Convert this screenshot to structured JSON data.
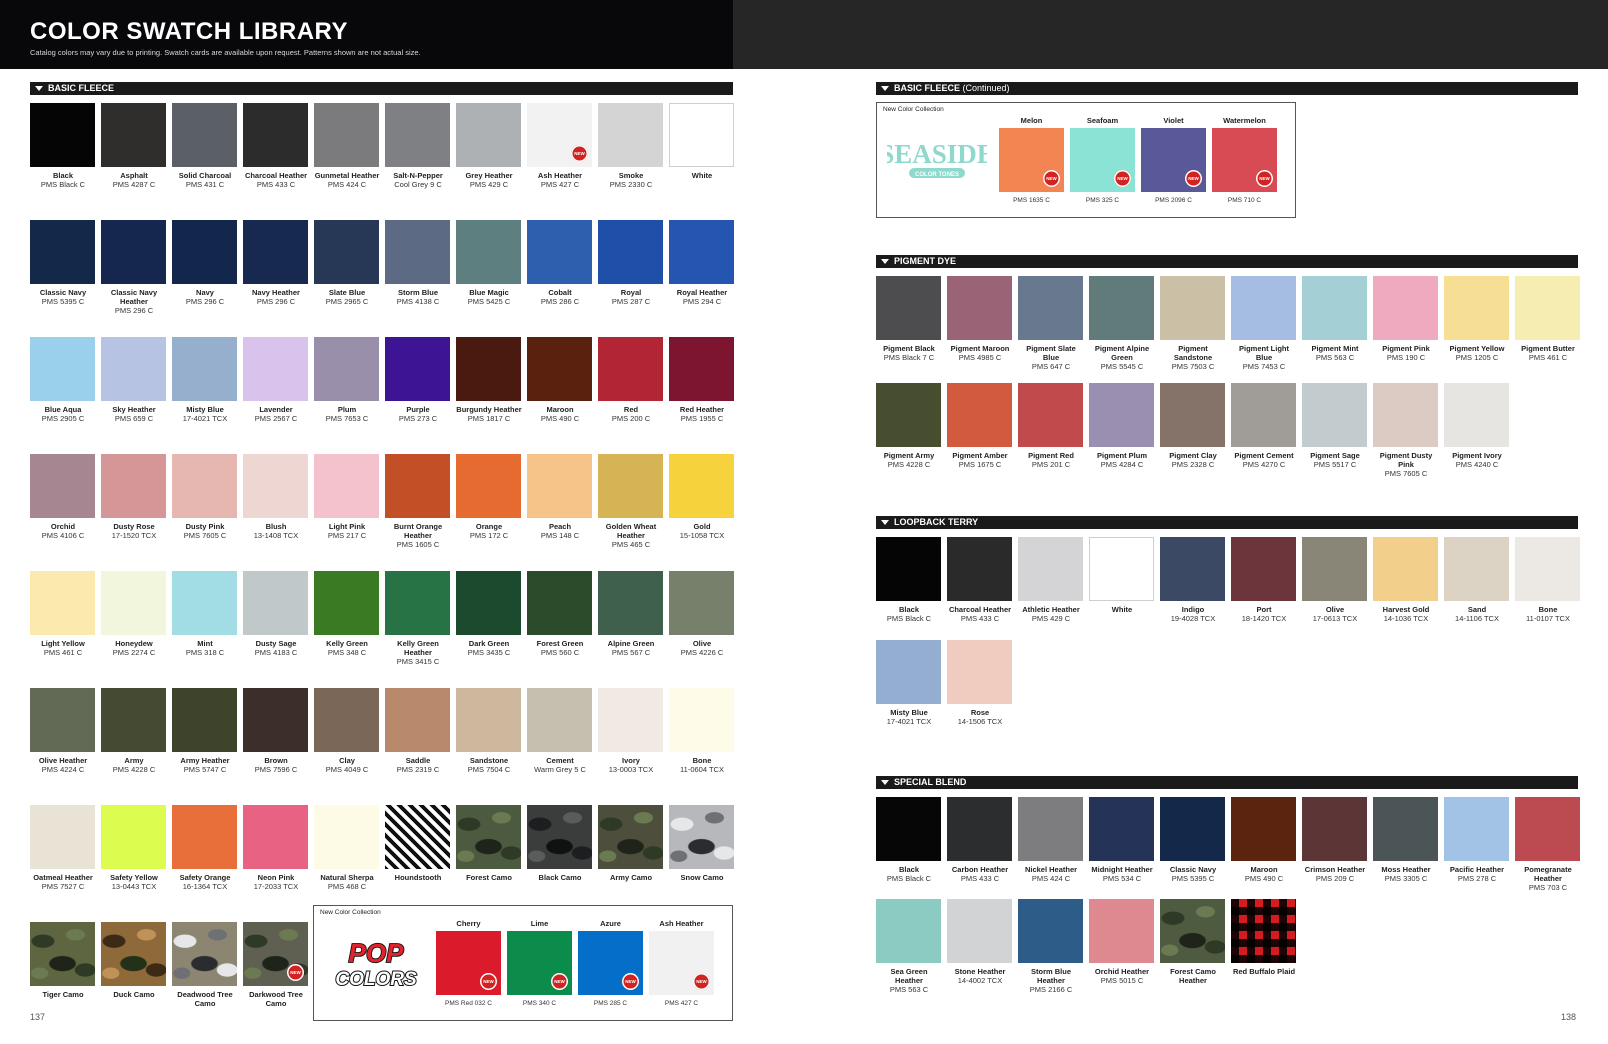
{
  "header": {
    "title": "COLOR SWATCH LIBRARY",
    "subtitle": "Catalog colors may vary due to printing. Swatch cards are available upon request. Patterns shown are not actual size."
  },
  "pages": {
    "left": "137",
    "right": "138"
  },
  "sections": {
    "basic_fleece": "BASIC FLEECE",
    "basic_fleece_cont": "BASIC FLEECE",
    "basic_fleece_cont_note": "(Continued)",
    "pigment_dye": "PIGMENT DYE",
    "loopback_terry": "LOOPBACK TERRY",
    "special_blend": "SPECIAL BLEND"
  },
  "new_badge": "NEW",
  "basic_fleece": [
    {
      "name": "Black",
      "pms": "PMS Black C",
      "color": "#050505"
    },
    {
      "name": "Asphalt",
      "pms": "PMS 4287 C",
      "color": "#302e2d"
    },
    {
      "name": "Solid Charcoal",
      "pms": "PMS 431 C",
      "color": "#5b6066"
    },
    {
      "name": "Charcoal Heather",
      "pms": "PMS 433 C",
      "color": "#2c2c2d"
    },
    {
      "name": "Gunmetal Heather",
      "pms": "PMS 424 C",
      "color": "#7b7b7d"
    },
    {
      "name": "Salt-N-Pepper",
      "pms": "Cool Grey 9 C",
      "color": "#7f8083"
    },
    {
      "name": "Grey Heather",
      "pms": "PMS 429 C",
      "color": "#aeb1b4"
    },
    {
      "name": "Ash Heather",
      "pms": "PMS 427 C",
      "color": "#f2f2f2",
      "new": true
    },
    {
      "name": "Smoke",
      "pms": "PMS 2330 C",
      "color": "#d4d4d4"
    },
    {
      "name": "White",
      "pms": "",
      "color": "#ffffff",
      "border": true
    },
    {
      "name": "Classic Navy",
      "pms": "PMS 5395 C",
      "color": "#14284a"
    },
    {
      "name": "Classic Navy Heather",
      "pms": "PMS 296 C",
      "color": "#15264f"
    },
    {
      "name": "Navy",
      "pms": "PMS 296 C",
      "color": "#13264c"
    },
    {
      "name": "Navy Heather",
      "pms": "PMS 296 C",
      "color": "#17294e"
    },
    {
      "name": "Slate Blue",
      "pms": "PMS 2965 C",
      "color": "#263855"
    },
    {
      "name": "Storm Blue",
      "pms": "PMS 4138 C",
      "color": "#5c6a84"
    },
    {
      "name": "Blue Magic",
      "pms": "PMS 5425 C",
      "color": "#5d7f80"
    },
    {
      "name": "Cobalt",
      "pms": "PMS 286 C",
      "color": "#2c5fad"
    },
    {
      "name": "Royal",
      "pms": "PMS 287 C",
      "color": "#1f4fa8"
    },
    {
      "name": "Royal Heather",
      "pms": "PMS 294 C",
      "color": "#2455b0"
    },
    {
      "name": "Blue Aqua",
      "pms": "PMS 2905 C",
      "color": "#9ad0ec"
    },
    {
      "name": "Sky Heather",
      "pms": "PMS 659 C",
      "color": "#b6c3e2"
    },
    {
      "name": "Misty Blue",
      "pms": "17-4021 TCX",
      "color": "#96afcc"
    },
    {
      "name": "Lavender",
      "pms": "PMS 2567 C",
      "color": "#d9c2ec"
    },
    {
      "name": "Plum",
      "pms": "PMS 7653 C",
      "color": "#9a8fab"
    },
    {
      "name": "Purple",
      "pms": "PMS 273 C",
      "color": "#3d1594"
    },
    {
      "name": "Burgundy Heather",
      "pms": "PMS 1817 C",
      "color": "#4a1a10"
    },
    {
      "name": "Maroon",
      "pms": "PMS 490 C",
      "color": "#5a220e"
    },
    {
      "name": "Red",
      "pms": "PMS 200 C",
      "color": "#b22534"
    },
    {
      "name": "Red Heather",
      "pms": "PMS 1955 C",
      "color": "#7e1530"
    },
    {
      "name": "Orchid",
      "pms": "PMS 4106 C",
      "color": "#a68690"
    },
    {
      "name": "Dusty Rose",
      "pms": "17-1520 TCX",
      "color": "#d49696"
    },
    {
      "name": "Dusty Pink",
      "pms": "PMS 7605 C",
      "color": "#e5b7b0"
    },
    {
      "name": "Blush",
      "pms": "13-1408 TCX",
      "color": "#eed6d2"
    },
    {
      "name": "Light Pink",
      "pms": "PMS 217 C",
      "color": "#f3c2cc"
    },
    {
      "name": "Burnt Orange Heather",
      "pms": "PMS 1605 C",
      "color": "#c24f25"
    },
    {
      "name": "Orange",
      "pms": "PMS 172 C",
      "color": "#e56b30"
    },
    {
      "name": "Peach",
      "pms": "PMS 148 C",
      "color": "#f6c488"
    },
    {
      "name": "Golden Wheat Heather",
      "pms": "PMS 465 C",
      "color": "#d6b354"
    },
    {
      "name": "Gold",
      "pms": "15-1058 TCX",
      "color": "#f6d23c"
    },
    {
      "name": "Light Yellow",
      "pms": "PMS 461 C",
      "color": "#fbe9ae"
    },
    {
      "name": "Honeydew",
      "pms": "PMS 2274 C",
      "color": "#f2f6dd"
    },
    {
      "name": "Mint",
      "pms": "PMS 318 C",
      "color": "#a2dde5"
    },
    {
      "name": "Dusty Sage",
      "pms": "PMS 4183 C",
      "color": "#c1c8c9"
    },
    {
      "name": "Kelly Green",
      "pms": "PMS 348 C",
      "color": "#3a7a22"
    },
    {
      "name": "Kelly Green Heather",
      "pms": "PMS 3415 C",
      "color": "#287345"
    },
    {
      "name": "Dark Green",
      "pms": "PMS 3435 C",
      "color": "#1c4a2e"
    },
    {
      "name": "Forest Green",
      "pms": "PMS 560 C",
      "color": "#2b4c2a"
    },
    {
      "name": "Alpine Green",
      "pms": "PMS 567 C",
      "color": "#3f604c"
    },
    {
      "name": "Olive",
      "pms": "PMS 4226 C",
      "color": "#77806a"
    },
    {
      "name": "Olive Heather",
      "pms": "PMS 4224 C",
      "color": "#626a55"
    },
    {
      "name": "Army",
      "pms": "PMS 4228 C",
      "color": "#444b32"
    },
    {
      "name": "Army Heather",
      "pms": "PMS 5747 C",
      "color": "#3e432b"
    },
    {
      "name": "Brown",
      "pms": "PMS 7596 C",
      "color": "#3c2e29"
    },
    {
      "name": "Clay",
      "pms": "PMS 4049 C",
      "color": "#7b6757"
    },
    {
      "name": "Saddle",
      "pms": "PMS 2319 C",
      "color": "#b8896a"
    },
    {
      "name": "Sandstone",
      "pms": "PMS 7504 C",
      "color": "#cdb89d"
    },
    {
      "name": "Cement",
      "pms": "Warm Grey 5 C",
      "color": "#c4bfaf"
    },
    {
      "name": "Ivory",
      "pms": "13-0003 TCX",
      "color": "#f1eae4"
    },
    {
      "name": "Bone",
      "pms": "11-0604 TCX",
      "color": "#fefbe8"
    },
    {
      "name": "Oatmeal Heather",
      "pms": "PMS 7527 C",
      "color": "#e8e3d5"
    },
    {
      "name": "Safety Yellow",
      "pms": "13-0443 TCX",
      "color": "#dcfd50"
    },
    {
      "name": "Safety Orange",
      "pms": "16-1364 TCX",
      "color": "#e96f3a"
    },
    {
      "name": "Neon Pink",
      "pms": "17-2033 TCX",
      "color": "#e86383"
    },
    {
      "name": "Natural Sherpa",
      "pms": "PMS 468 C",
      "color": "#fdfae5"
    },
    {
      "name": "Houndstooth",
      "pms": "",
      "color": "#ffffff",
      "pattern": "houndstooth"
    },
    {
      "name": "Forest Camo",
      "pms": "",
      "color": "#4c5a40",
      "pattern": "camo"
    },
    {
      "name": "Black Camo",
      "pms": "",
      "color": "#3b3c3c",
      "pattern": "camo-dark"
    },
    {
      "name": "Army Camo",
      "pms": "",
      "color": "#4d4f3c",
      "pattern": "camo"
    },
    {
      "name": "Snow Camo",
      "pms": "",
      "color": "#b6b8bb",
      "pattern": "camo-light"
    },
    {
      "name": "Tiger Camo",
      "pms": "",
      "color": "#5d6641",
      "pattern": "camo"
    },
    {
      "name": "Duck Camo",
      "pms": "",
      "color": "#8e6a3b",
      "pattern": "camo-brown"
    },
    {
      "name": "Deadwood Tree Camo",
      "pms": "",
      "color": "#8c8572",
      "pattern": "camo-light"
    },
    {
      "name": "Darkwood Tree Camo",
      "pms": "",
      "color": "#606052",
      "pattern": "camo",
      "new": true
    }
  ],
  "pop_colors": {
    "label": "New Color Collection",
    "logo_top": "POP",
    "logo_bottom": "COLORS",
    "swatches": [
      {
        "name": "Cherry",
        "pms": "PMS Red 032 C",
        "color": "#db1a2b"
      },
      {
        "name": "Lime",
        "pms": "PMS 340 C",
        "color": "#0b8c4a"
      },
      {
        "name": "Azure",
        "pms": "PMS 285 C",
        "color": "#056ec9"
      },
      {
        "name": "Ash Heather",
        "pms": "PMS 427 C",
        "color": "#f1f1f1"
      }
    ]
  },
  "seaside": {
    "label": "New Color Collection",
    "logo_top": "SEASIDE",
    "logo_bottom": "COLOR TONES",
    "swatches": [
      {
        "name": "Melon",
        "pms": "PMS 1635 C",
        "color": "#f38553"
      },
      {
        "name": "Seafoam",
        "pms": "PMS 325 C",
        "color": "#8ae3d5"
      },
      {
        "name": "Violet",
        "pms": "PMS 2096 C",
        "color": "#59599a"
      },
      {
        "name": "Watermelon",
        "pms": "PMS 710 C",
        "color": "#d84a54"
      }
    ]
  },
  "pigment_dye": [
    {
      "name": "Pigment Black",
      "pms": "PMS Black 7 C",
      "color": "#4d4d4f"
    },
    {
      "name": "Pigment Maroon",
      "pms": "PMS 4985 C",
      "color": "#9a6476"
    },
    {
      "name": "Pigment Slate Blue",
      "pms": "PMS 647 C",
      "color": "#68788f"
    },
    {
      "name": "Pigment Alpine Green",
      "pms": "PMS 5545 C",
      "color": "#617b7b"
    },
    {
      "name": "Pigment Sandstone",
      "pms": "PMS 7503 C",
      "color": "#cbbfa6"
    },
    {
      "name": "Pigment Light Blue",
      "pms": "PMS 7453 C",
      "color": "#a5bde3"
    },
    {
      "name": "Pigment Mint",
      "pms": "PMS 563 C",
      "color": "#a4cfd4"
    },
    {
      "name": "Pigment Pink",
      "pms": "PMS 190 C",
      "color": "#efaac0"
    },
    {
      "name": "Pigment Yellow",
      "pms": "PMS 1205 C",
      "color": "#f6df95"
    },
    {
      "name": "Pigment Butter",
      "pms": "PMS 461 C",
      "color": "#f6edb0"
    },
    {
      "name": "Pigment Army",
      "pms": "PMS 4228 C",
      "color": "#474d2f"
    },
    {
      "name": "Pigment Amber",
      "pms": "PMS 1675 C",
      "color": "#d25a3e"
    },
    {
      "name": "Pigment Red",
      "pms": "PMS 201 C",
      "color": "#bf4b4d"
    },
    {
      "name": "Pigment Plum",
      "pms": "PMS 4284 C",
      "color": "#9a8fb0"
    },
    {
      "name": "Pigment Clay",
      "pms": "PMS 2328 C",
      "color": "#857369"
    },
    {
      "name": "Pigment Cement",
      "pms": "PMS 4270 C",
      "color": "#a09d98"
    },
    {
      "name": "Pigment Sage",
      "pms": "PMS 5517 C",
      "color": "#c2cbcd"
    },
    {
      "name": "Pigment Dusty Pink",
      "pms": "PMS 7605 C",
      "color": "#dccbc2"
    },
    {
      "name": "Pigment Ivory",
      "pms": "PMS 4240 C",
      "color": "#e7e5e2"
    }
  ],
  "loopback_terry": [
    {
      "name": "Black",
      "pms": "PMS Black C",
      "color": "#050505"
    },
    {
      "name": "Charcoal Heather",
      "pms": "PMS 433 C",
      "color": "#2a2a2b"
    },
    {
      "name": "Athletic Heather",
      "pms": "PMS 429 C",
      "color": "#d4d4d6"
    },
    {
      "name": "White",
      "pms": "",
      "color": "#ffffff",
      "border": true
    },
    {
      "name": "Indigo",
      "pms": "19-4028 TCX",
      "color": "#3c4964"
    },
    {
      "name": "Port",
      "pms": "18-1420 TCX",
      "color": "#6c353c"
    },
    {
      "name": "Olive",
      "pms": "17-0613 TCX",
      "color": "#8a8677"
    },
    {
      "name": "Harvest Gold",
      "pms": "14-1036 TCX",
      "color": "#f2cf8a"
    },
    {
      "name": "Sand",
      "pms": "14-1106 TCX",
      "color": "#dcd3c4"
    },
    {
      "name": "Bone",
      "pms": "11-0107 TCX",
      "color": "#ece8e3"
    },
    {
      "name": "Misty Blue",
      "pms": "17-4021 TCX",
      "color": "#93aed1"
    },
    {
      "name": "Rose",
      "pms": "14-1506 TCX",
      "color": "#f0cbc0"
    }
  ],
  "special_blend": [
    {
      "name": "Black",
      "pms": "PMS Black C",
      "color": "#060606"
    },
    {
      "name": "Carbon Heather",
      "pms": "PMS 433 C",
      "color": "#2c2d2f"
    },
    {
      "name": "Nickel Heather",
      "pms": "PMS 424 C",
      "color": "#7d7d80"
    },
    {
      "name": "Midnight Heather",
      "pms": "PMS 534 C",
      "color": "#253358"
    },
    {
      "name": "Classic Navy",
      "pms": "PMS 5395 C",
      "color": "#14284a"
    },
    {
      "name": "Maroon",
      "pms": "PMS 490 C",
      "color": "#5b240e"
    },
    {
      "name": "Crimson Heather",
      "pms": "PMS 209 C",
      "color": "#5c3637"
    },
    {
      "name": "Moss Heather",
      "pms": "PMS 3305 C",
      "color": "#4b5557"
    },
    {
      "name": "Pacific Heather",
      "pms": "PMS 278 C",
      "color": "#a3c3e6"
    },
    {
      "name": "Pomegranate Heather",
      "pms": "PMS 703 C",
      "color": "#bb4b50"
    },
    {
      "name": "Sea Green Heather",
      "pms": "PMS 563 C",
      "color": "#8bcbc2"
    },
    {
      "name": "Stone Heather",
      "pms": "14-4002 TCX",
      "color": "#d2d3d4"
    },
    {
      "name": "Storm Blue Heather",
      "pms": "PMS 2166 C",
      "color": "#2c5c87"
    },
    {
      "name": "Orchid Heather",
      "pms": "PMS 5015 C",
      "color": "#de8890"
    },
    {
      "name": "Forest Camo Heather",
      "pms": "",
      "color": "#4e5b40",
      "pattern": "camo"
    },
    {
      "name": "Red Buffalo Plaid",
      "pms": "",
      "color": "#d11d22",
      "pattern": "plaid"
    }
  ]
}
